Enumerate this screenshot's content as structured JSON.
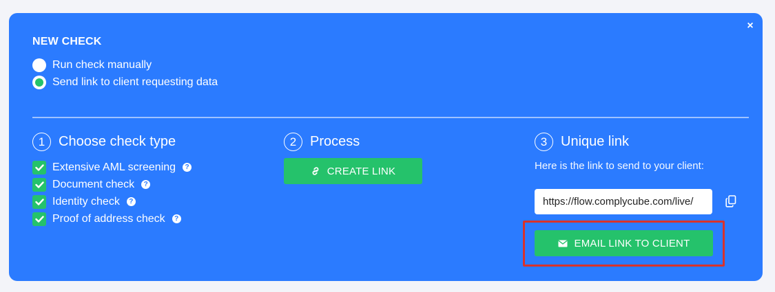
{
  "modal": {
    "close_glyph": "×",
    "title": "NEW CHECK",
    "options": [
      {
        "label": "Run check manually",
        "selected": false
      },
      {
        "label": "Send link to client requesting data",
        "selected": true
      }
    ]
  },
  "steps": {
    "check_type": {
      "number": "1",
      "title": "Choose check type",
      "items": [
        {
          "label": "Extensive AML screening",
          "checked": true
        },
        {
          "label": "Document check",
          "checked": true
        },
        {
          "label": "Identity check",
          "checked": true
        },
        {
          "label": "Proof of address check",
          "checked": true
        }
      ]
    },
    "process": {
      "number": "2",
      "title": "Process",
      "button_label": "CREATE LINK",
      "button_icon": "link-icon"
    },
    "unique_link": {
      "number": "3",
      "title": "Unique link",
      "hint": "Here is the link to send to your client:",
      "link_value": "https://flow.complycube.com/live/",
      "copy_icon": "copy-icon",
      "email_button_label": "EMAIL LINK TO CLIENT",
      "email_icon": "envelope-icon"
    }
  },
  "colors": {
    "panel": "#2b7bff",
    "accent_green": "#25c26b",
    "highlight": "#d8322b",
    "background": "#f3f4f9"
  }
}
